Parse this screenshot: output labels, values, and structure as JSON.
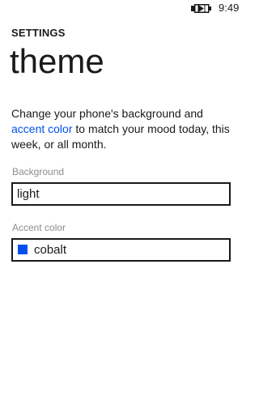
{
  "status": {
    "time": "9:49",
    "battery_icon": "battery-charging-icon"
  },
  "header": {
    "app_title": "SETTINGS",
    "page_title": "theme"
  },
  "description": {
    "before": "Change your phone's background and ",
    "link": "accent color",
    "after": " to match your mood today, this week, or all month."
  },
  "background": {
    "label": "Background",
    "value": "light"
  },
  "accent": {
    "label": "Accent color",
    "value": "cobalt",
    "color": "#0050ef"
  },
  "colors": {
    "accent": "#0050ef",
    "text": "#1a1a1a",
    "label": "#8c8c8c",
    "background": "#ffffff"
  }
}
